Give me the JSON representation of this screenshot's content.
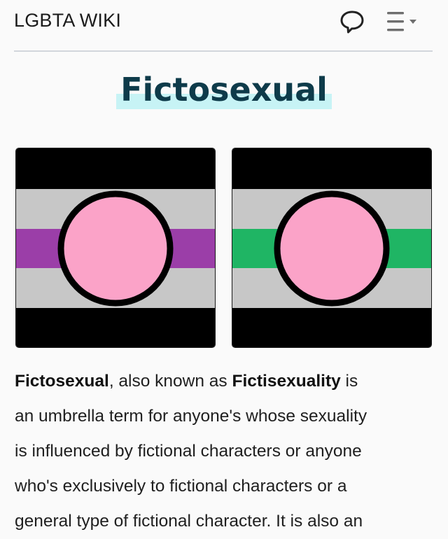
{
  "header": {
    "site_name": "LGBTA WIKI",
    "icons": [
      "chat-bubble-icon",
      "menu-icon"
    ]
  },
  "page": {
    "title": "Fictosexual"
  },
  "flags": [
    {
      "name": "fictosexual-flag-purple",
      "colors": {
        "top": "#000000",
        "light": "#c7c7c7",
        "center": "#9b3ea8",
        "circle": "#fba3c8",
        "outline": "#000000"
      }
    },
    {
      "name": "fictosexual-flag-green",
      "colors": {
        "top": "#000000",
        "light": "#c7c7c7",
        "center": "#1fb564",
        "circle": "#fba3c8",
        "outline": "#000000"
      }
    }
  ],
  "article": {
    "line1": {
      "term1": "Fictosexual",
      "text1": ", also known as ",
      "term2": "Fictisexuality",
      "text2": " is"
    },
    "line2": "an umbrella term for anyone's whose sexuality",
    "line3": "is influenced by fictional characters or anyone",
    "line4": "who's exclusively to fictional characters or a",
    "line5": "general type of fictional character. It is also an"
  },
  "colors": {
    "title_text": "#0e3b4a",
    "title_highlight": "#c7f3f5",
    "divider": "#d2d6dc"
  }
}
